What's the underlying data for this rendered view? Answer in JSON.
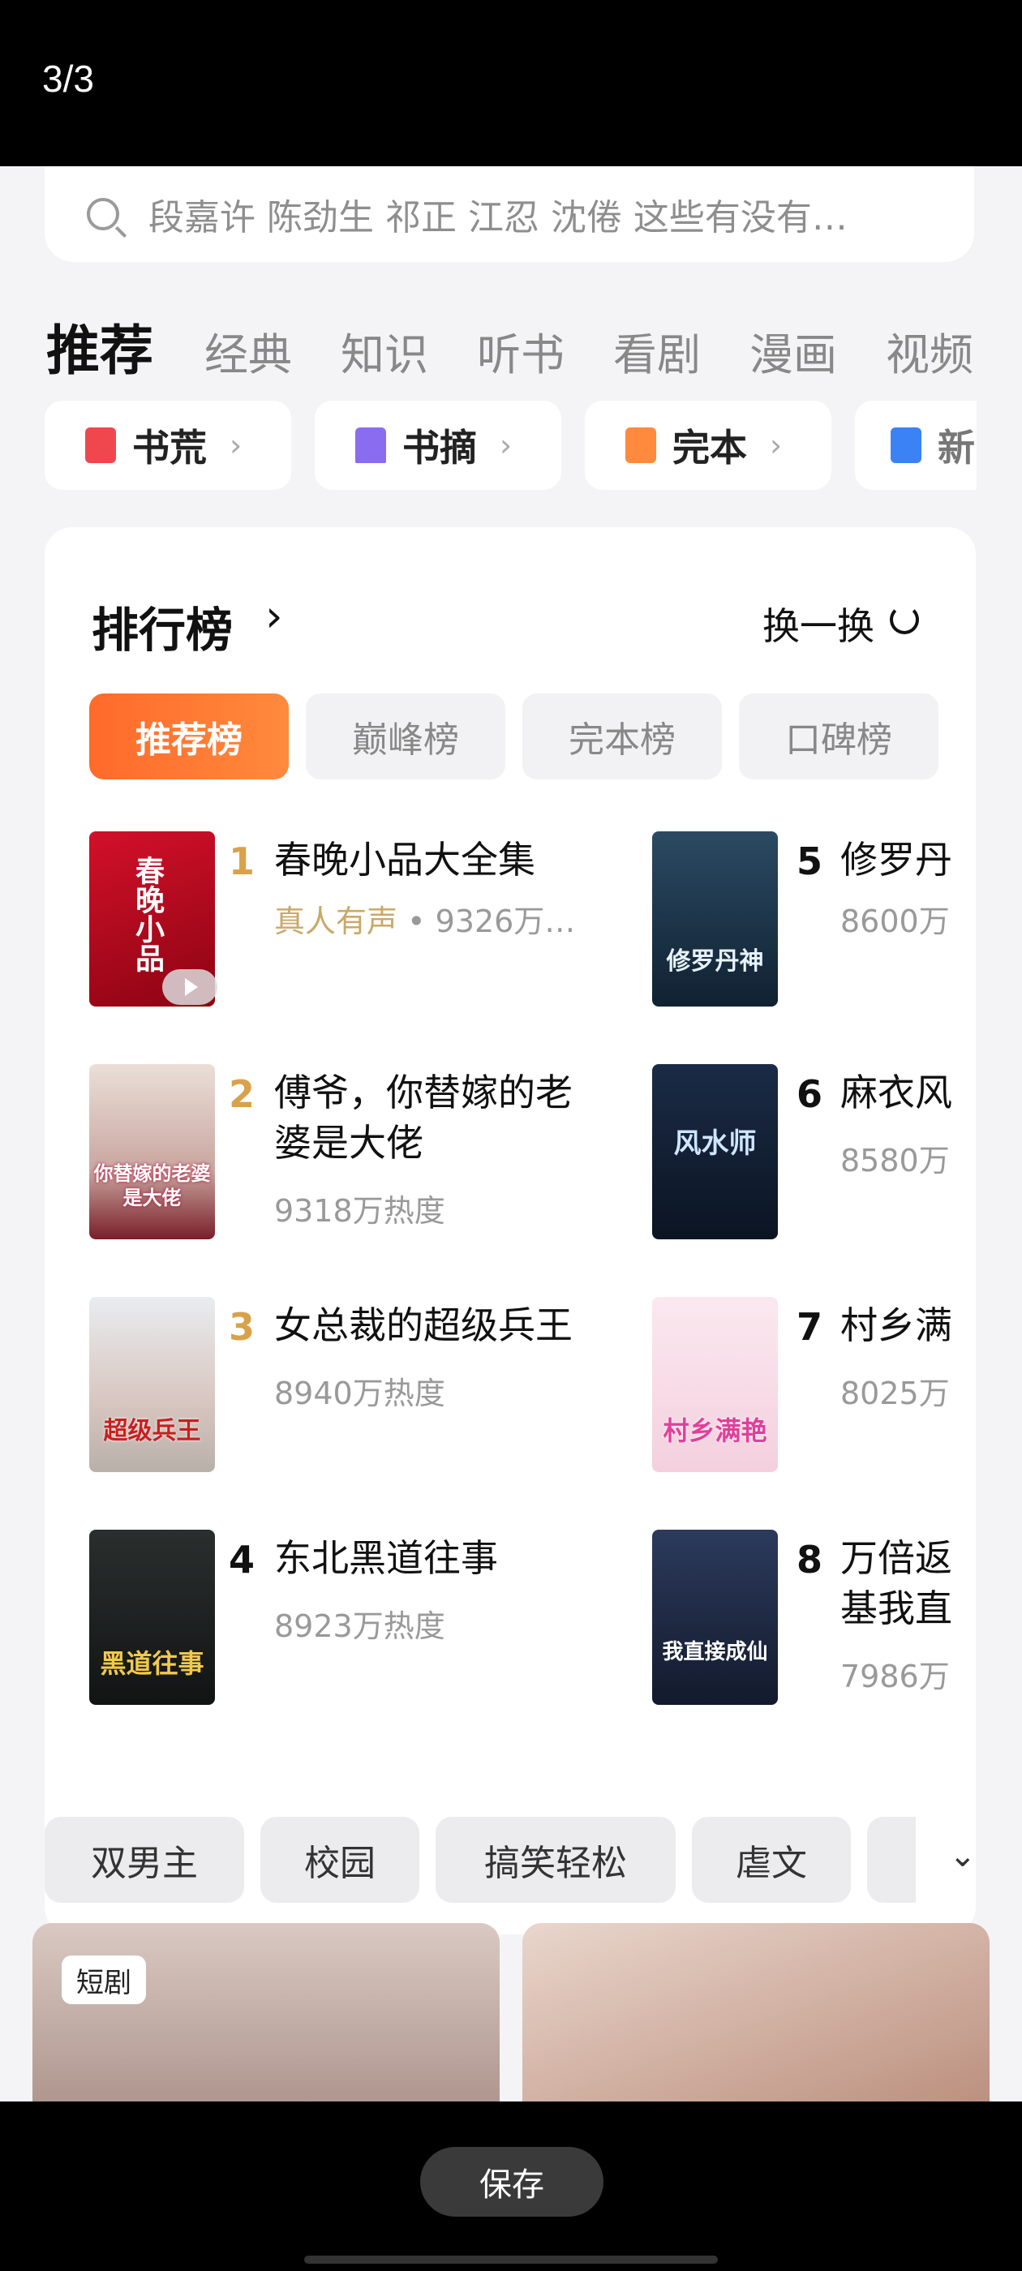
{
  "viewer": {
    "page_indicator": "3/3",
    "save_label": "保存"
  },
  "search": {
    "placeholder": "段嘉许 陈劲生 祁正 江忍 沈倦 这些有没有…"
  },
  "tabs": [
    {
      "label": "推荐",
      "active": true
    },
    {
      "label": "经典"
    },
    {
      "label": "知识"
    },
    {
      "label": "听书"
    },
    {
      "label": "看剧"
    },
    {
      "label": "漫画"
    },
    {
      "label": "视频"
    }
  ],
  "chips": [
    {
      "label": "书荒",
      "icon": "hash-tag-icon",
      "color": "#f0474f"
    },
    {
      "label": "书摘",
      "icon": "bookmark-icon",
      "color": "#8a6cf0"
    },
    {
      "label": "完本",
      "icon": "book-icon",
      "color": "#ff8a3d"
    },
    {
      "label": "新",
      "icon": "new-flag-icon",
      "color": "#3b82f6"
    }
  ],
  "ranking": {
    "title": "排行榜",
    "refresh_label": "换一换",
    "subtabs": [
      "推荐榜",
      "巅峰榜",
      "完本榜",
      "口碑榜"
    ],
    "books": [
      {
        "rank": "1",
        "title": "春晚小品大全集",
        "meta_voice": "真人有声",
        "meta": " • 9326万…",
        "cover_text": "春晚小品"
      },
      {
        "rank": "2",
        "title_line1": "傅爷，你替嫁的老",
        "title_line2": "婆是大佬",
        "meta": "9318万热度",
        "cover_text": "你替嫁的老婆是大佬"
      },
      {
        "rank": "3",
        "title": "女总裁的超级兵王",
        "meta": "8940万热度",
        "cover_text": "超级兵王"
      },
      {
        "rank": "4",
        "title": "东北黑道往事",
        "meta": "8923万热度",
        "cover_text": "黑道往事"
      },
      {
        "rank": "5",
        "title": "修罗丹",
        "meta": "8600万",
        "cover_text": "修罗丹神"
      },
      {
        "rank": "6",
        "title": "麻衣风",
        "meta": "8580万",
        "cover_text": "风水师"
      },
      {
        "rank": "7",
        "title": "村乡满",
        "meta": "8025万",
        "cover_text": "村乡满艳"
      },
      {
        "rank": "8",
        "title_line1": "万倍返",
        "title_line2": "基我直",
        "meta": "7986万",
        "cover_text": "我直接成仙"
      }
    ]
  },
  "tags": [
    "双男主",
    "校园",
    "搞笑轻松",
    "虐文"
  ],
  "feed": {
    "short_badge": "短剧"
  }
}
